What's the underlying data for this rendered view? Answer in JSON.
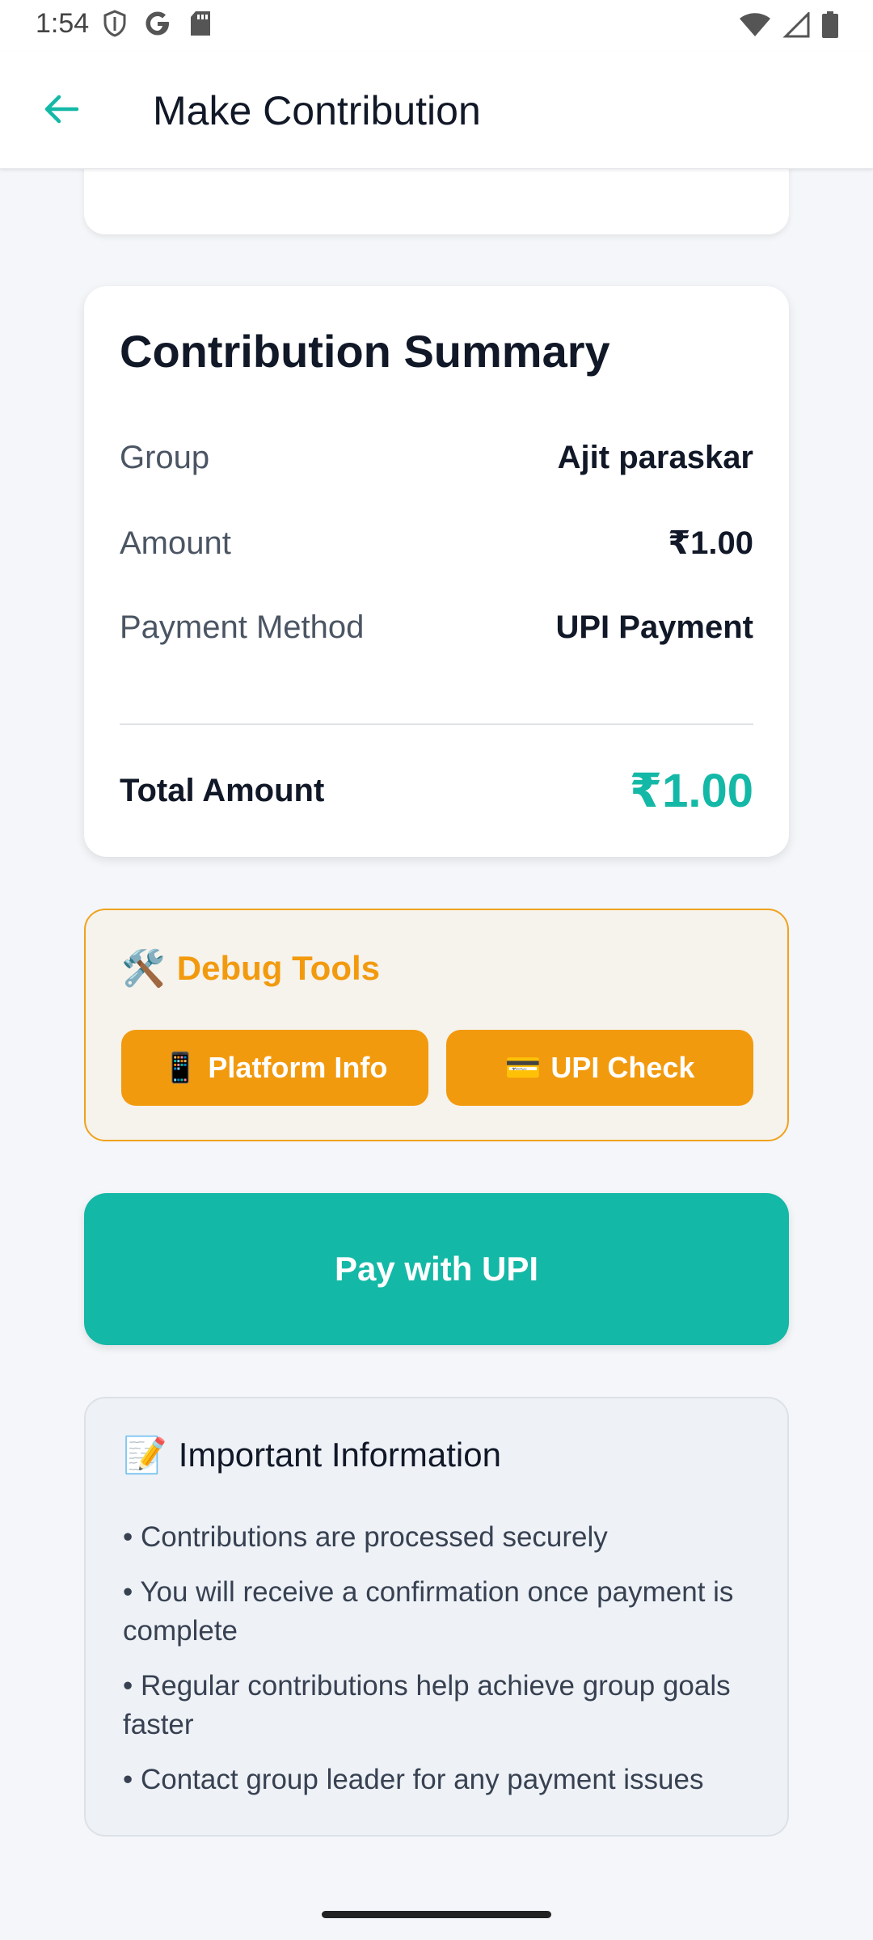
{
  "status_bar": {
    "time": "1:54",
    "left_icons": [
      "shield-icon",
      "google-icon",
      "sd-card-icon"
    ],
    "right_icons": [
      "wifi-icon",
      "signal-icon",
      "battery-icon"
    ]
  },
  "app_bar": {
    "title": "Make Contribution",
    "back_icon": "arrow-left-icon",
    "accent": "#14b8a6"
  },
  "summary": {
    "title": "Contribution Summary",
    "rows": [
      {
        "label": "Group",
        "value": "Ajit paraskar"
      },
      {
        "label": "Amount",
        "value": "₹1.00"
      },
      {
        "label": "Payment Method",
        "value": "UPI Payment"
      }
    ],
    "total_label": "Total Amount",
    "total_value": "₹1.00"
  },
  "debug_tools": {
    "emoji": "🛠️",
    "title": "Debug Tools",
    "buttons": [
      {
        "emoji": "📱",
        "label": "Platform Info"
      },
      {
        "emoji": "💳",
        "label": "UPI Check"
      }
    ],
    "accent": "#f29a0e"
  },
  "pay_button": {
    "label": "Pay with UPI"
  },
  "info": {
    "emoji": "📝",
    "title": "Important Information",
    "items": [
      "• Contributions are processed securely",
      "• You will receive a confirmation once payment is complete",
      "• Regular contributions help achieve group goals faster",
      "• Contact group leader for any payment issues"
    ]
  }
}
